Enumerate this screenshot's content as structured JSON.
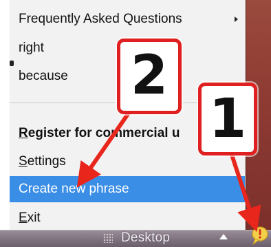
{
  "menu": {
    "items": [
      {
        "label": "Frequently Asked Questions",
        "has_submenu": true
      },
      {
        "label": "right"
      },
      {
        "label": "because"
      },
      {
        "label": "Register for commercial u",
        "bold": true
      },
      {
        "label": "Settings"
      },
      {
        "label": "Create new phrase",
        "highlighted": true
      },
      {
        "label": "Exit"
      }
    ]
  },
  "taskbar": {
    "desktop_label": "Desktop"
  },
  "annotations": {
    "badge_1": "1",
    "badge_2": "2"
  },
  "colors": {
    "highlight": "#3b8ee6",
    "annotation_red": "#e02020",
    "menu_bg": "#f2f2f2"
  },
  "icons": {
    "submenu": "chevron-right-icon",
    "up_arrow": "tray-up-arrow-icon",
    "tray_app": "speech-bubble-exclamation-icon"
  }
}
